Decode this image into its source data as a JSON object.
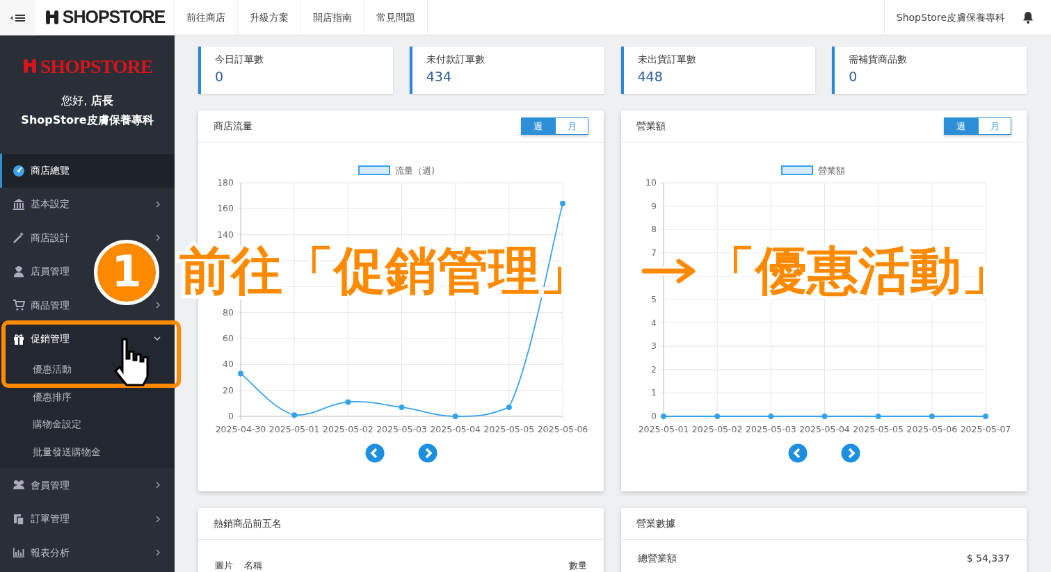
{
  "topbar": {
    "logo": "SHOPSTORE",
    "nav": [
      "前往商店",
      "升級方案",
      "開店指南",
      "常見問題"
    ],
    "store_name": "ShopStore皮膚保養專科"
  },
  "sidebar": {
    "logo": "SHOPSTORE",
    "greeting": "您好, **店長**",
    "store": "ShopStore皮膚保養專科",
    "items": [
      {
        "label": "商店總覽",
        "selected": true
      },
      {
        "label": "基本設定",
        "selected": false,
        "expanded": false
      },
      {
        "label": "商店設計",
        "selected": false,
        "expanded": false
      },
      {
        "label": "店員管理",
        "selected": false
      },
      {
        "label": "商品管理",
        "selected": false,
        "expanded": false
      },
      {
        "label": "促銷管理",
        "selected": false,
        "expanded": true,
        "children": [
          {
            "label": "優惠活動"
          },
          {
            "label": "優惠排序"
          },
          {
            "label": "購物金設定"
          },
          {
            "label": "批量發送購物金"
          }
        ]
      },
      {
        "label": "會員管理",
        "selected": false,
        "expanded": false
      },
      {
        "label": "訂單管理",
        "selected": false,
        "expanded": false
      },
      {
        "label": "報表分析",
        "selected": false,
        "expanded": false
      }
    ]
  },
  "stats": [
    {
      "label": "今日訂單數",
      "value": "0"
    },
    {
      "label": "未付款訂單數",
      "value": "434"
    },
    {
      "label": "未出貨訂單數",
      "value": "448"
    },
    {
      "label": "需補貨商品數",
      "value": "0"
    }
  ],
  "charts": [
    {
      "title": "商店流量",
      "toggle": [
        {
          "label": "週",
          "selected": true
        },
        {
          "label": "月",
          "selected": false
        }
      ],
      "chart_data": {
        "type": "line",
        "categories": [
          "2025-04-30",
          "2025-05-01",
          "2025-05-02",
          "2025-05-03",
          "2025-05-04",
          "2025-05-05",
          "2025-05-06"
        ],
        "ylim": [
          0,
          180
        ],
        "yticks": [
          0,
          20,
          40,
          60,
          80,
          140,
          160,
          180
        ],
        "grid": true,
        "series": [
          {
            "name": "流量（週)",
            "color": "#36a2eb",
            "marker": true,
            "values": [
              33,
              1,
              11,
              7,
              0,
              7,
              164
            ]
          }
        ]
      }
    },
    {
      "title": "營業額",
      "toggle": [
        {
          "label": "週",
          "selected": true
        },
        {
          "label": "月",
          "selected": false
        }
      ],
      "chart_data": {
        "type": "line",
        "categories": [
          "2025-05-01",
          "2025-05-02",
          "2025-05-03",
          "2025-05-04",
          "2025-05-05",
          "2025-05-06",
          "2025-05-07"
        ],
        "ylim": [
          0,
          10
        ],
        "yticks": [
          0,
          1,
          2,
          3,
          4,
          5,
          7,
          8,
          9,
          10
        ],
        "grid": true,
        "series": [
          {
            "name": "營業額",
            "color": "#36a2eb",
            "marker": true,
            "values": [
              0,
              0,
              0,
              0,
              0,
              0,
              0
            ]
          }
        ]
      }
    }
  ],
  "top_products": {
    "title": "熱銷商品前五名",
    "columns": [
      "圖片",
      "名稱",
      "數量"
    ]
  },
  "business": {
    "title": "營業數據",
    "rows": [
      {
        "label": "總營業額",
        "value": "$ 54,337"
      }
    ]
  },
  "annotation": {
    "step": "1",
    "texts": [
      "前往「促銷管理」",
      "「優惠活動」"
    ]
  }
}
